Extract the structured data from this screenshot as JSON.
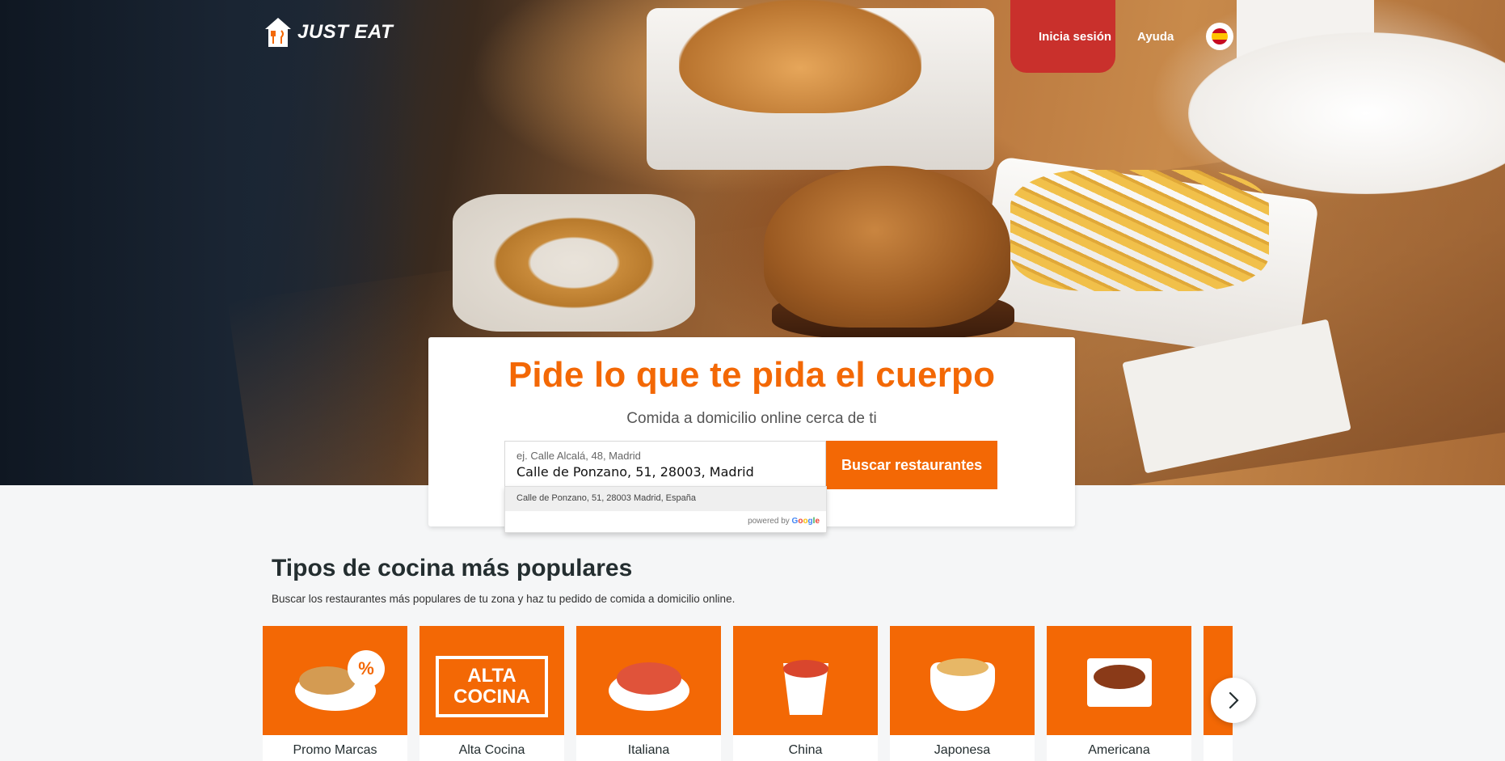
{
  "brand": {
    "name": "JUST EAT",
    "accent": "#f36805"
  },
  "nav": {
    "login": "Inicia sesión",
    "help": "Ayuda",
    "language": "es-flag-icon"
  },
  "hero": {
    "title": "Pide lo que te pida el cuerpo",
    "subtitle": "Comida a domicilio online cerca de ti",
    "address_placeholder": "ej. Calle Alcalá, 48, Madrid",
    "address_value": "Calle de Ponzano, 51, 28003, Madrid",
    "search_button": "Buscar restaurantes",
    "suggestion": "Calle de Ponzano, 51, 28003 Madrid, España",
    "powered_by": "powered by",
    "google": [
      "G",
      "o",
      "o",
      "g",
      "l",
      "e"
    ]
  },
  "cuisines": {
    "title": "Tipos de cocina más populares",
    "subtitle": "Buscar los restaurantes más populares de tu zona y haz tu pedido de comida a domicilio online.",
    "items": [
      {
        "label": "Promo Marcas",
        "badge": "%"
      },
      {
        "label": "Alta Cocina",
        "art_text": "ALTA COCINA"
      },
      {
        "label": "Italiana"
      },
      {
        "label": "China"
      },
      {
        "label": "Japonesa"
      },
      {
        "label": "Americana"
      }
    ]
  }
}
